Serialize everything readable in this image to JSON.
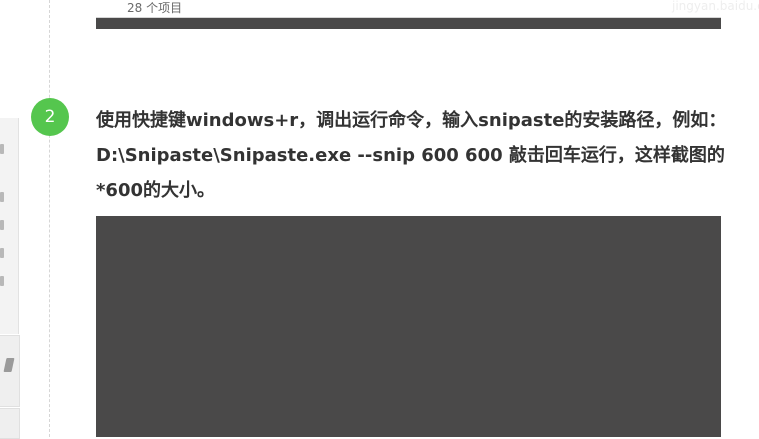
{
  "previous_image": {
    "item_count": "28 个项目",
    "watermark": "jingyan.baidu.com"
  },
  "step": {
    "number": "2",
    "lines": [
      "使用快捷键windows+r，调出运行命令，输入snipaste的安装路径，例如：",
      "D:\\Snipaste\\Snipaste.exe --snip 600 600   敲击回车运行，这样截图的",
      "*600的大小。"
    ]
  },
  "colors": {
    "badge": "#55c64e",
    "text": "#333333",
    "image_bg": "#4a4949"
  }
}
